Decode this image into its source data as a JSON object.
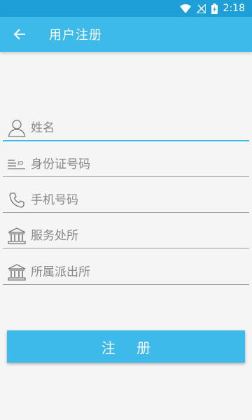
{
  "status_bar": {
    "time": "2:18"
  },
  "app_bar": {
    "title": "用户注册",
    "back_icon": "arrow-left-icon"
  },
  "form": {
    "fields": [
      {
        "name": "name",
        "placeholder": "姓名",
        "icon": "person-icon"
      },
      {
        "name": "id_number",
        "placeholder": "身份证号码",
        "icon": "id-card-icon"
      },
      {
        "name": "phone",
        "placeholder": "手机号码",
        "icon": "phone-icon"
      },
      {
        "name": "service_office",
        "placeholder": "服务处所",
        "icon": "bank-building-icon"
      },
      {
        "name": "police_station",
        "placeholder": "所属派出所",
        "icon": "bank-building-icon"
      }
    ],
    "submit_label": "注 册"
  },
  "colors": {
    "primary": "#3db9ea",
    "status_bar": "#1f9fd7",
    "background": "#f5f5f5"
  }
}
